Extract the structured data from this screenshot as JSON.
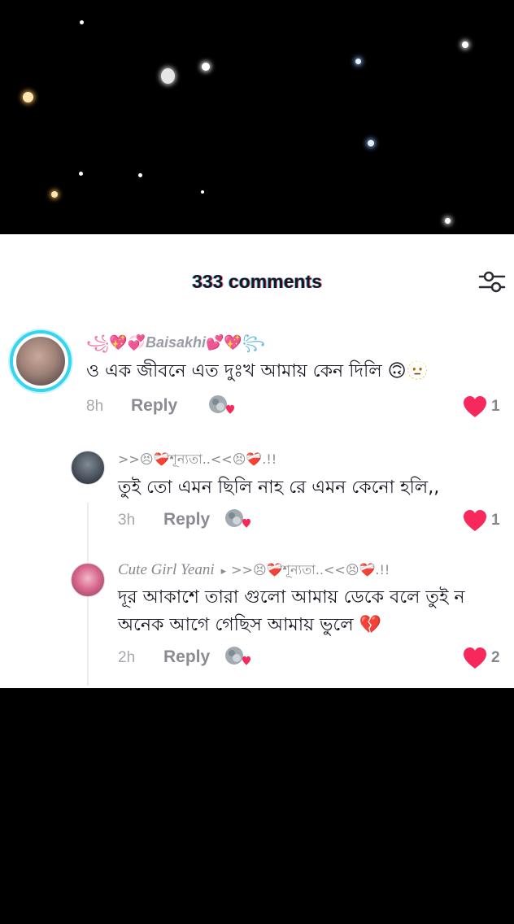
{
  "header": {
    "comment_count_label": "333 comments"
  },
  "colors": {
    "like_heart": "#f6285c",
    "text_primary": "#161823",
    "text_secondary": "#8a8b91",
    "sheet_background": "#ffffff",
    "video_background": "#000000"
  },
  "comments": [
    {
      "user_prefix": "꧁",
      "user_deco_left": "💖💞",
      "username": "Baisakhi",
      "user_deco_right": "💕💖",
      "user_suffix": "꧂",
      "text": "ও এক জীবনে এত দুঃখ আমায় কেন দিলি 🙃🫥",
      "time": "8h",
      "reply_label": "Reply",
      "likes": "1",
      "replies": [
        {
          "username": ">>😣❤️‍🩹শূন্যতা..<<😣❤️‍🩹.!!",
          "text": "তুই তো এমন ছিলি নাহ রে এমন কেনো হলি,,",
          "time": "3h",
          "reply_label": "Reply",
          "likes": "1"
        },
        {
          "username": "Cute Girl Yeani",
          "reply_to_arrow": "▸",
          "reply_to": ">>😣❤️‍🩹শূন্যতা..<<😣❤️‍🩹.!!",
          "text_line1": "দূর আকাশে তারা গুলো আমায় ডেকে বলে তুই ন",
          "text_line2": "অনেক আগে গেছিস আমায় ভুলে 💔",
          "time": "2h",
          "reply_label": "Reply",
          "likes": "2"
        }
      ]
    }
  ]
}
